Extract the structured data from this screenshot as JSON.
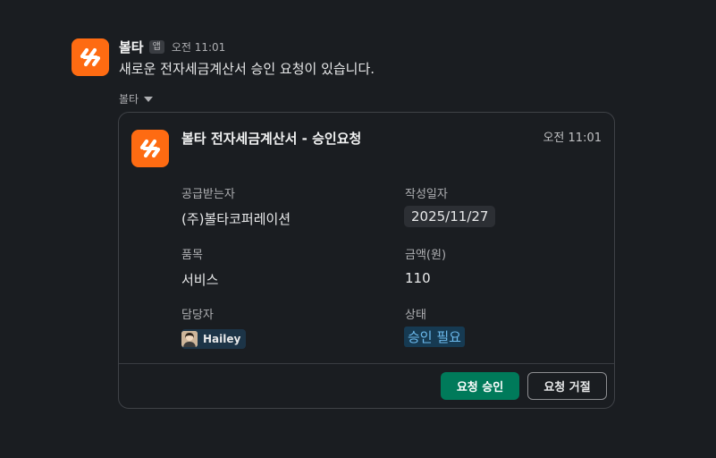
{
  "message": {
    "sender": "볼타",
    "app_badge": "앱",
    "time": "오전 11:01",
    "text": "새로운 전자세금계산서 승인 요청이 있습니다.",
    "attachment_label": "볼타"
  },
  "card": {
    "title": "볼타 전자세금계산서 - 승인요청",
    "time": "오전 11:01",
    "fields": {
      "supplier_label": "공급받는자",
      "supplier_value": "(주)볼타코퍼레이션",
      "date_label": "작성일자",
      "date_value": "2025/11/27",
      "item_label": "품목",
      "item_value": "서비스",
      "amount_label": "금액(원)",
      "amount_value": "110",
      "owner_label": "담당자",
      "owner_value": "Hailey",
      "status_label": "상태",
      "status_value": "승인 필요"
    },
    "actions": {
      "approve": "요청 승인",
      "reject": "요청 거절"
    }
  },
  "colors": {
    "brand": "#fe6b12",
    "approve_button": "#007a5a",
    "status_text": "#6cb9ec"
  }
}
